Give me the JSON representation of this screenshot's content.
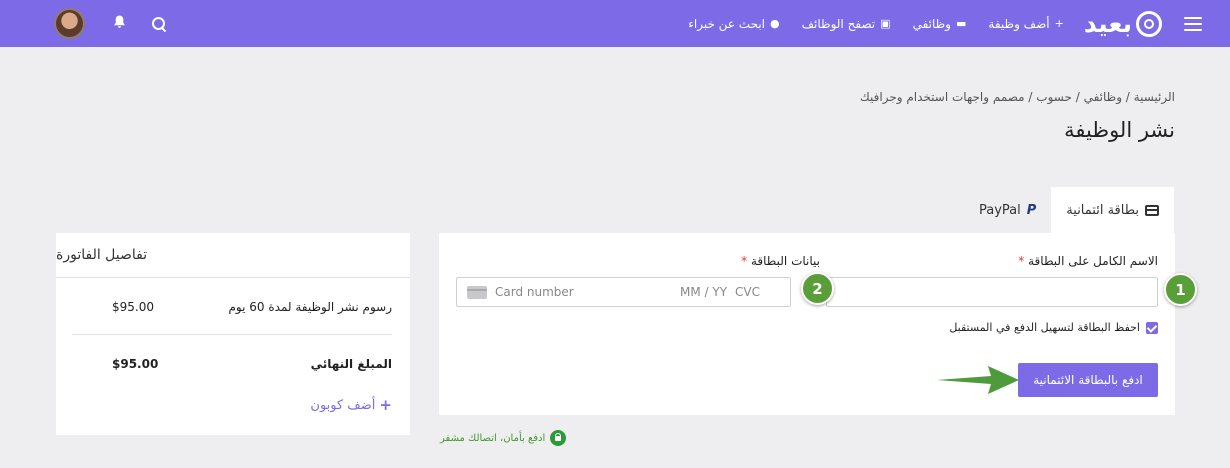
{
  "nav": {
    "logo_text": "بعيد",
    "items": [
      {
        "label": "أضف وظيفة",
        "icon": "+"
      },
      {
        "label": "وظائفي",
        "icon": "▬"
      },
      {
        "label": "تصفح الوظائف",
        "icon": "▣"
      },
      {
        "label": "ابحث عن خبراء",
        "icon": "●"
      }
    ]
  },
  "breadcrumb": "الرئيسية / وظائفي / حسوب / مصمم واجهات استخدام وجرافيك",
  "page_title": "نشر الوظيفة",
  "tabs": [
    {
      "label": "بطاقة ائتمانية"
    },
    {
      "label": "PayPal",
      "icon": "P"
    }
  ],
  "form": {
    "name_label": "الاسم الكامل على البطاقة",
    "card_label": "بيانات البطاقة",
    "required_mark": "*",
    "card_placeholder": "Card number",
    "card_expiry": "MM / YY",
    "card_cvc": "CVC",
    "save_card_label": "احفظ البطاقة لتسهيل الدفع في المستقبل",
    "save_card_checked": true,
    "pay_button": "ادفع بالبطاقة الائتمانية",
    "step_badges": [
      "1",
      "2"
    ]
  },
  "invoice": {
    "title": "تفاصيل الفاتورة",
    "line_label": "رسوم نشر الوظيفة لمدة 60 يوم",
    "line_amount": "$95.00",
    "total_label": "المبلغ النهائي",
    "total_amount": "$95.00",
    "coupon_label": "أضف كوبون"
  },
  "secure_note": "ادفع بأمان، اتصالك مشفر",
  "colors": {
    "accent": "#7d6ae6",
    "badge": "#5a9e3a",
    "arrow": "#4f9a3c",
    "secure": "#2d9a3a"
  }
}
